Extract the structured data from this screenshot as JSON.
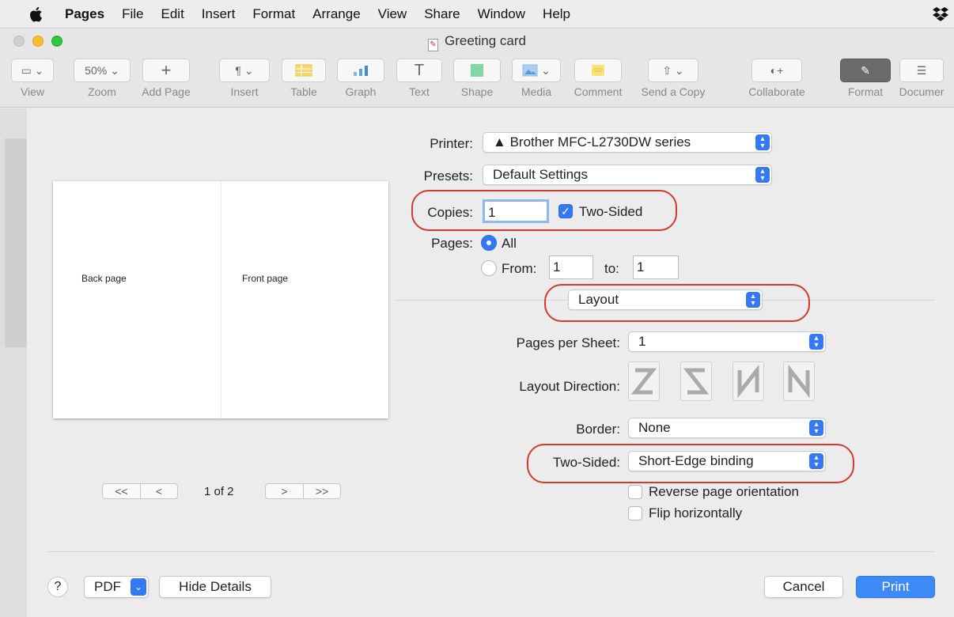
{
  "menubar": {
    "items": [
      "Pages",
      "File",
      "Edit",
      "Insert",
      "Format",
      "Arrange",
      "View",
      "Share",
      "Window",
      "Help"
    ]
  },
  "window": {
    "title": "Greeting card"
  },
  "toolbar": {
    "view": {
      "label": "View"
    },
    "zoom": {
      "label": "Zoom",
      "value": "50%"
    },
    "add_page": {
      "label": "Add Page"
    },
    "insert": {
      "label": "Insert"
    },
    "table": {
      "label": "Table"
    },
    "graph": {
      "label": "Graph"
    },
    "text": {
      "label": "Text"
    },
    "shape": {
      "label": "Shape"
    },
    "media": {
      "label": "Media"
    },
    "comment": {
      "label": "Comment"
    },
    "send_copy": {
      "label": "Send a Copy"
    },
    "collaborate": {
      "label": "Collaborate"
    },
    "format": {
      "label": "Format"
    },
    "document": {
      "label": "Documer"
    }
  },
  "preview": {
    "back_page": "Back page",
    "front_page": "Front page",
    "page_indicator": "1 of 2",
    "first": "<<",
    "prev": "<",
    "next": ">",
    "last": ">>"
  },
  "print": {
    "printer_label": "Printer:",
    "printer_value": "Brother MFC-L2730DW series",
    "presets_label": "Presets:",
    "presets_value": "Default Settings",
    "copies_label": "Copies:",
    "copies_value": "1",
    "two_sided_label": "Two-Sided",
    "two_sided_checked": true,
    "pages_label": "Pages:",
    "pages_all": "All",
    "pages_from": "From:",
    "pages_from_value": "1",
    "pages_to": "to:",
    "pages_to_value": "1",
    "section_value": "Layout",
    "pages_per_sheet_label": "Pages per Sheet:",
    "pages_per_sheet_value": "1",
    "layout_direction_label": "Layout Direction:",
    "border_label": "Border:",
    "border_value": "None",
    "two_sided_mode_label": "Two-Sided:",
    "two_sided_mode_value": "Short-Edge binding",
    "reverse_orientation": "Reverse page orientation",
    "flip_horizontally": "Flip horizontally"
  },
  "footer": {
    "help": "?",
    "pdf": "PDF",
    "hide_details": "Hide Details",
    "cancel": "Cancel",
    "print": "Print"
  },
  "colors": {
    "accent": "#3478f6",
    "highlight_ring": "#d33a2c"
  }
}
